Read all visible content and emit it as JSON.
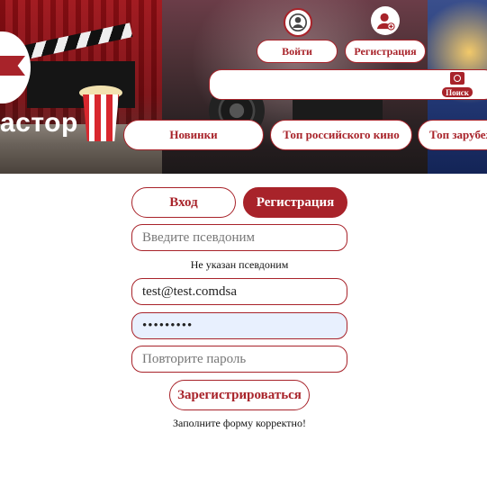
{
  "header": {
    "logo_text": "астор",
    "login_label": "Войти",
    "register_label": "Регистрация",
    "search": {
      "value": "",
      "placeholder": "",
      "button_label": "Поиск"
    },
    "nav": [
      {
        "label": "Новинки"
      },
      {
        "label": "Топ российского кино"
      },
      {
        "label": "Топ зарубежного кино"
      }
    ]
  },
  "form": {
    "tabs": {
      "login": "Вход",
      "register": "Регистрация",
      "active": "register"
    },
    "nickname": {
      "value": "",
      "placeholder": "Введите псевдоним"
    },
    "nickname_error": "Не указан псевдоним",
    "email": {
      "value": "test@test.comdsa",
      "placeholder": ""
    },
    "password": {
      "value": "•••••••••",
      "placeholder": ""
    },
    "password_repeat": {
      "value": "",
      "placeholder": "Повторите пароль"
    },
    "submit_label": "Зарегистрироваться",
    "status_message": "Заполните форму корректно!"
  },
  "colors": {
    "accent": "#a8232a",
    "autofill_bg": "#e8f0fe"
  },
  "icons": {
    "login": "user-circle-icon",
    "register": "user-add-icon",
    "search": "search-icon"
  }
}
